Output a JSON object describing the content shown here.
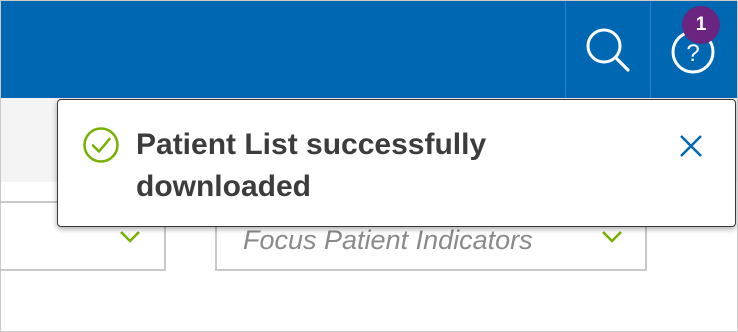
{
  "header": {
    "notification_count": "1",
    "search_icon": "search-icon",
    "help_icon": "help-icon"
  },
  "filters": {
    "focus_indicators_placeholder": "Focus Patient Indicators"
  },
  "toast": {
    "message": "Patient List successfully downloaded",
    "icon": "check-circle-icon"
  },
  "colors": {
    "header_bg": "#0067b3",
    "badge": "#6b2580",
    "success": "#76b000",
    "close": "#0067b3"
  }
}
